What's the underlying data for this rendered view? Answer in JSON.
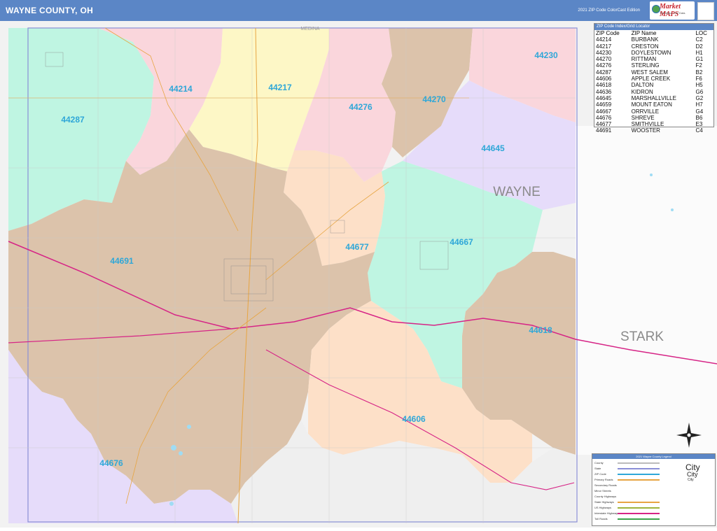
{
  "header": {
    "title": "WAYNE COUNTY, OH",
    "edition": "2021 ZIP Code ColorCast Edition",
    "logo_text": "Market MAPS",
    "logo_sub": "The Maps. The Data."
  },
  "map": {
    "neighbor_top": "MEDINA",
    "county_labels": [
      "WAYNE",
      "STARK"
    ],
    "zip_labels": [
      "44214",
      "44217",
      "44230",
      "44270",
      "44276",
      "44287",
      "44645",
      "44667",
      "44677",
      "44691",
      "44618",
      "44606",
      "44676"
    ],
    "colors": {
      "tan": "#dcc3ab",
      "pink": "#fad6dc",
      "yellow": "#fdf7c6",
      "aqua": "#bff5e2",
      "peach": "#fde0c8",
      "lavender": "#e6dcfa",
      "gray": "#efefef",
      "zip_label": "#2fa7d8",
      "interstate": "#d62486",
      "highway": "#e7a542"
    }
  },
  "index": {
    "heading": "ZIP Code Index/Grid Locator",
    "columns": [
      "ZIP Code",
      "ZIP Name",
      "LOC"
    ],
    "rows": [
      [
        "44214",
        "BURBANK",
        "C2"
      ],
      [
        "44217",
        "CRESTON",
        "D2"
      ],
      [
        "44230",
        "DOYLESTOWN",
        "H1"
      ],
      [
        "44270",
        "RITTMAN",
        "G1"
      ],
      [
        "44276",
        "STERLING",
        "F2"
      ],
      [
        "44287",
        "WEST SALEM",
        "B2"
      ],
      [
        "44606",
        "APPLE CREEK",
        "F6"
      ],
      [
        "44618",
        "DALTON",
        "H5"
      ],
      [
        "44636",
        "KIDRON",
        "G6"
      ],
      [
        "44645",
        "MARSHALLVILLE",
        "G2"
      ],
      [
        "44659",
        "MOUNT EATON",
        "H7"
      ],
      [
        "44667",
        "ORRVILLE",
        "G4"
      ],
      [
        "44676",
        "SHREVE",
        "B6"
      ],
      [
        "44677",
        "SMITHVILLE",
        "E3"
      ],
      [
        "44691",
        "WOOSTER",
        "C4"
      ]
    ]
  },
  "legend": {
    "heading": "2021 Wayne County Legend",
    "rows": [
      "County",
      "State",
      "ZIP Code",
      "Primary Roads",
      "Secondary Roads",
      "Minor Streets",
      "County Highways",
      "State Highways",
      "US Highways",
      "Interstate Highways",
      "Toll Roads"
    ],
    "city_big": "City",
    "city_med": "City",
    "city_sm": "City"
  }
}
